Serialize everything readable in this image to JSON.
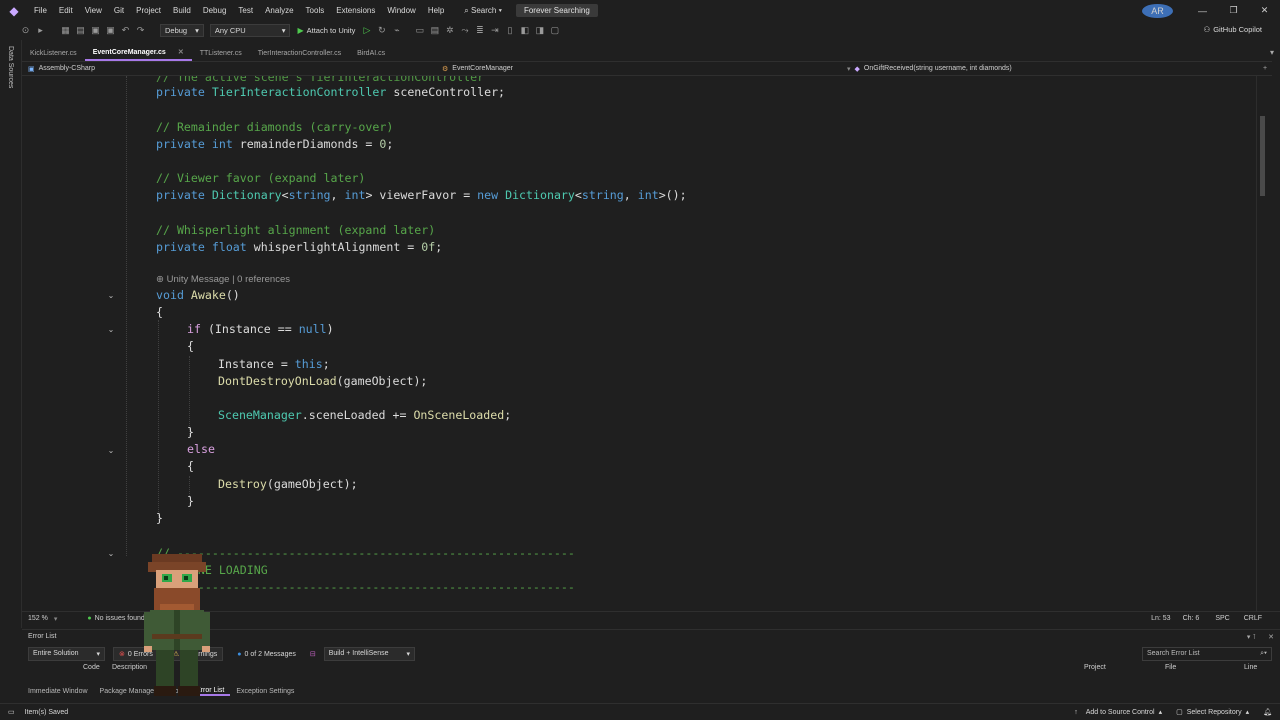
{
  "menubar": {
    "items": [
      "File",
      "Edit",
      "View",
      "Git",
      "Project",
      "Build",
      "Debug",
      "Test",
      "Analyze",
      "Tools",
      "Extensions",
      "Window",
      "Help"
    ],
    "search": "Search",
    "solution_name": "Forever Searching",
    "user_initials": "AR"
  },
  "toolbar": {
    "config": "Debug",
    "platform": "Any CPU",
    "attach": "Attach to Unity",
    "copilot": "GitHub Copilot"
  },
  "left_strip": {
    "label": "Data Sources"
  },
  "doc_tabs": [
    {
      "label": "KickListener.cs",
      "active": false
    },
    {
      "label": "EventCoreManager.cs",
      "active": true
    },
    {
      "label": "TTListener.cs",
      "active": false
    },
    {
      "label": "TierInteractionController.cs",
      "active": false
    },
    {
      "label": "BirdAI.cs",
      "active": false
    }
  ],
  "navbar": {
    "project": "Assembly-CSharp",
    "class": "EventCoreManager",
    "member": "OnGiftReceived(string username, int diamonds)"
  },
  "code": {
    "l0": "// The active scene's TierInteractionController",
    "l1_kw": "private",
    "l1_type": "TierInteractionController",
    "l1_rest": " sceneController;",
    "c2": "// Remainder diamonds (carry-over)",
    "l3_kw": "private",
    "l3_t": "int",
    "l3_name": " remainderDiamonds = ",
    "l3_num": "0",
    "l3_end": ";",
    "c4": "// Viewer favor (expand later)",
    "l5_kw": "private",
    "l5_t1": "Dictionary",
    "l5_a": "<",
    "l5_t2": "string",
    "l5_b": ", ",
    "l5_t3": "int",
    "l5_c": "> viewerFavor = ",
    "l5_new": "new",
    "l5_sp": " ",
    "l5_t4": "Dictionary",
    "l5_d": "<",
    "l5_t5": "string",
    "l5_e": ", ",
    "l5_t6": "int",
    "l5_f": ">();",
    "c6": "// Whisperlight alignment (expand later)",
    "l7_kw": "private",
    "l7_t": "float",
    "l7_rest": " whisperlightAlignment = ",
    "l7_num": "0f",
    "l7_end": ";",
    "lens": "Unity Message | 0 references",
    "l8_kw": "void",
    "l8_fn": "Awake",
    "l8_rest": "()",
    "open1": "{",
    "l9_if": "if",
    "l9_a": " (Instance == ",
    "l9_null": "null",
    "l9_b": ")",
    "open2": "{",
    "l10_a": "Instance = ",
    "l10_this": "this",
    "l10_b": ";",
    "l11_fn": "DontDestroyOnLoad",
    "l11_rest": "(gameObject);",
    "l12_ty": "SceneManager",
    "l12_rest": ".sceneLoaded += ",
    "l12_fn": "OnSceneLoaded",
    "l12_end": ";",
    "close2": "}",
    "l13_else": "else",
    "open3": "{",
    "l14_fn": "Destroy",
    "l14_rest": "(gameObject);",
    "close3": "}",
    "close1": "}",
    "c15": "// ---------------------------------------------------------",
    "c16": "// SCENE LOADING",
    "c17": "// ---------------------------------------------------------"
  },
  "editor_status": {
    "zoom": "152 %",
    "issues": "No issues found",
    "line": "Ln: 53",
    "col": "Ch: 6",
    "spc": "SPC",
    "eol": "CRLF"
  },
  "error_list": {
    "title": "Error List",
    "scope": "Entire Solution",
    "errors": "0 Errors",
    "warnings": "0 Warnings",
    "messages": "0 of 2 Messages",
    "build": "Build + IntelliSense",
    "search_placeholder": "Search Error List",
    "columns": [
      "Code",
      "Description",
      "Project",
      "File",
      "Line"
    ]
  },
  "bottom_tabs": [
    {
      "label": "Immediate Window",
      "active": false
    },
    {
      "label": "Package Manager Console",
      "active": false
    },
    {
      "label": "Error List",
      "active": true
    },
    {
      "label": "Exception Settings",
      "active": false
    }
  ],
  "statusbar": {
    "saved": "Item(s) Saved",
    "source_control": "Add to Source Control",
    "repo": "Select Repository"
  },
  "colors": {
    "accent": "#a779e8",
    "background": "#1f1f1f",
    "keyword": "#569cd6",
    "type": "#4ec9b0",
    "comment": "#57a64a"
  }
}
